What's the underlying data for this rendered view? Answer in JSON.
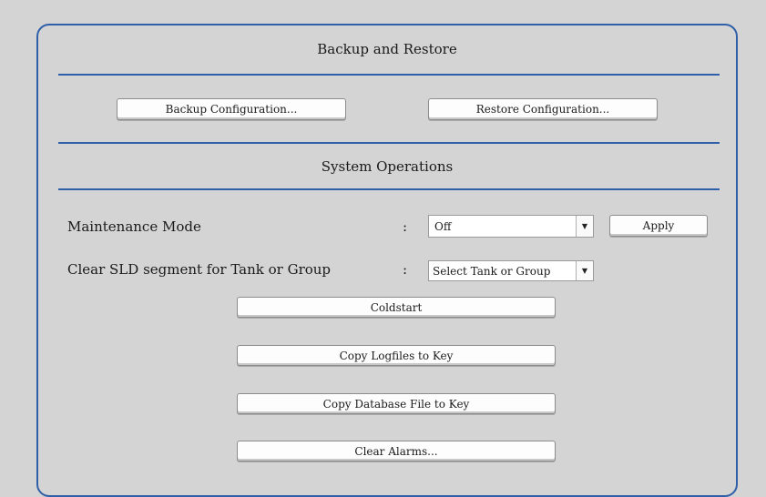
{
  "backup_section": {
    "title": "Backup and Restore",
    "backup_button": "Backup Configuration...",
    "restore_button": "Restore Configuration..."
  },
  "system_section": {
    "title": "System Operations",
    "maintenance": {
      "label": "Maintenance Mode",
      "separator": ":",
      "value": "Off",
      "apply_button": "Apply"
    },
    "clear_sld": {
      "label": "Clear SLD segment for Tank or Group",
      "separator": ":",
      "value": "Select Tank or Group"
    },
    "buttons": {
      "coldstart": "Coldstart",
      "copy_logfiles": "Copy Logfiles to Key",
      "copy_database": "Copy Database File to Key",
      "clear_alarms": "Clear Alarms..."
    }
  },
  "icons": {
    "dropdown": "chevron-down-icon"
  },
  "colors": {
    "accent": "#2f5fa8",
    "background": "#d4d4d4",
    "button": "#fdfdfd"
  }
}
